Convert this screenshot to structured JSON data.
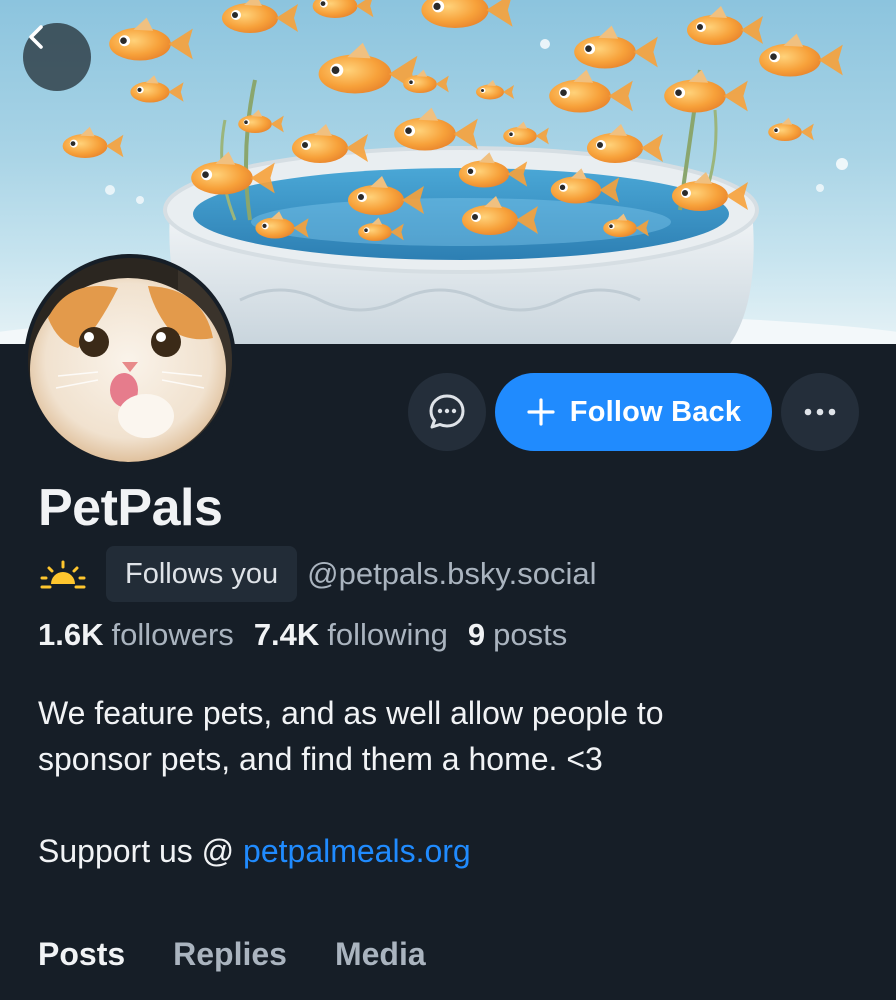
{
  "profile": {
    "display_name": "PetPals",
    "follows_you_badge": "Follows you",
    "handle": "@petpals.bsky.social",
    "stats": [
      {
        "count": "1.6K",
        "label": "followers"
      },
      {
        "count": "7.4K",
        "label": "following"
      },
      {
        "count": "9",
        "label": "posts"
      }
    ],
    "bio_line1": "We feature pets, and as well allow people to",
    "bio_line2": "sponsor pets, and find them a home. <3",
    "support_prefix": "Support us @ ",
    "support_link": "petpalmeals.org"
  },
  "actions": {
    "follow_label": "Follow Back"
  },
  "tabs": [
    {
      "label": "Posts",
      "active": true
    },
    {
      "label": "Replies",
      "active": false
    },
    {
      "label": "Media",
      "active": false
    }
  ],
  "icons": {
    "back": "chevron-left-icon",
    "message": "chat-bubble-icon",
    "follow": "plus-icon",
    "more": "ellipsis-icon",
    "status": "sunrise-icon"
  },
  "colors": {
    "background": "#161e27",
    "accent": "#208bfe",
    "muted_text": "#aab4bf",
    "button_dark": "#242e3a"
  }
}
